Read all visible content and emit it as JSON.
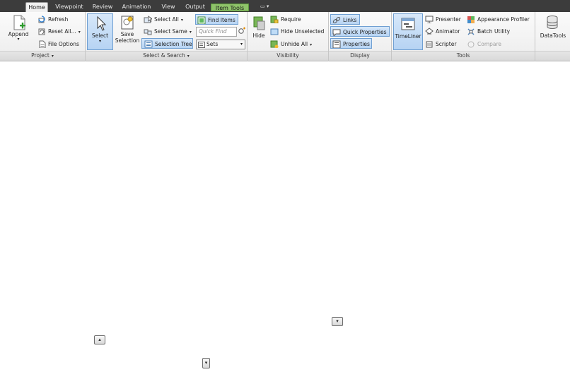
{
  "tabs": [
    "Home",
    "Viewpoint",
    "Review",
    "Animation",
    "View",
    "Output"
  ],
  "context_tab": "Item Tools",
  "quick_access": "▭ ▾",
  "groups": {
    "project": {
      "label": "Project",
      "append": "Append",
      "refresh": "Refresh",
      "reset_all": "Reset All...",
      "file_options": "File Options"
    },
    "select_search": {
      "label": "Select & Search",
      "select": "Select",
      "save_selection_1": "Save",
      "save_selection_2": "Selection",
      "select_all": "Select All",
      "select_same": "Select Same",
      "selection_tree": "Selection Tree",
      "find_items": "Find Items",
      "quick_find_placeholder": "Quick Find",
      "sets": "Sets"
    },
    "visibility": {
      "label": "Visibility",
      "hide": "Hide",
      "require": "Require",
      "hide_unselected": "Hide Unselected",
      "unhide_all": "Unhide All"
    },
    "display": {
      "label": "Display",
      "links": "Links",
      "quick_properties": "Quick Properties",
      "properties": "Properties"
    },
    "tools": {
      "label": "Tools",
      "timeliner": "TimeLiner",
      "presenter": "Presenter",
      "animator": "Animator",
      "scripter": "Scripter",
      "appearance_profiler": "Appearance Profiler",
      "batch_utility": "Batch Utility",
      "compare": "Compare"
    },
    "datatools": {
      "datatools": "DataTools"
    }
  },
  "colors": {
    "tabbar": "#3c3c3c",
    "context_tab": "#8fc36a",
    "highlight": "#b6d3f3",
    "accent_border": "#6f9fd2"
  },
  "canvas_controls": [
    "expand-control",
    "collapse-control",
    "dropdown-control"
  ]
}
